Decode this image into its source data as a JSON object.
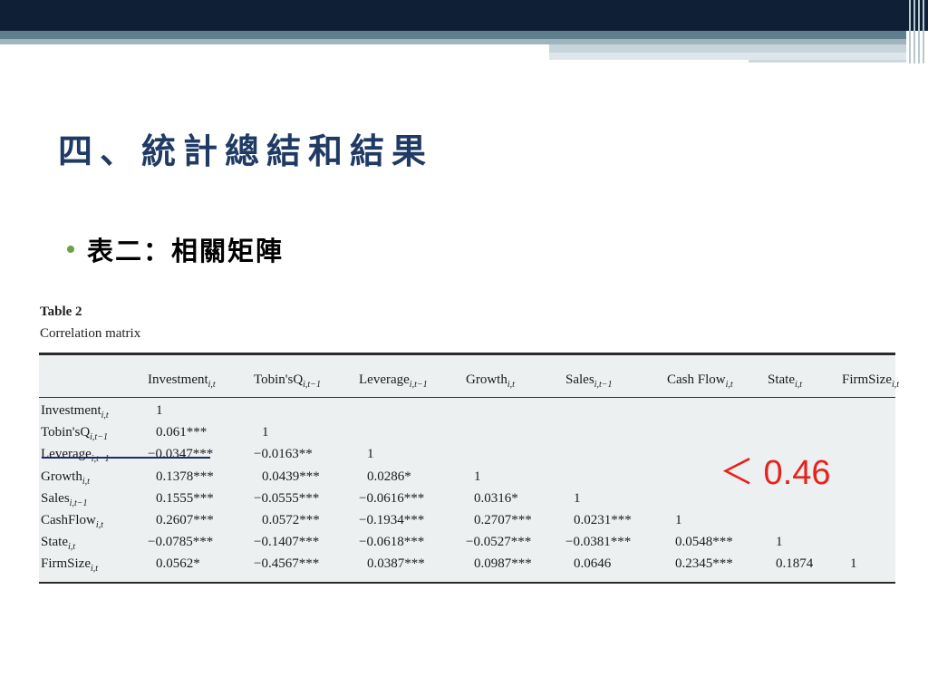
{
  "slide": {
    "title": "四、統計總結和結果",
    "bullet": "表二：相關矩陣"
  },
  "figure": {
    "label": "Table 2",
    "caption": "Correlation matrix"
  },
  "table": {
    "columns": [
      {
        "name": "Investment",
        "sub": "i,t"
      },
      {
        "name": "Tobin'sQ",
        "sub": "i,t−1"
      },
      {
        "name": "Leverage",
        "sub": "i,t−1"
      },
      {
        "name": "Growth",
        "sub": "i,t"
      },
      {
        "name": "Sales",
        "sub": "i,t−1"
      },
      {
        "name": "Cash Flow",
        "sub": "i,t"
      },
      {
        "name": "State",
        "sub": "i,t"
      },
      {
        "name": "FirmSize",
        "sub": "i,t"
      }
    ],
    "rows": [
      {
        "name": "Investment",
        "sub": "i,t",
        "values": [
          "1"
        ]
      },
      {
        "name": "Tobin'sQ",
        "sub": "i,t−1",
        "values": [
          "0.061***",
          "1"
        ]
      },
      {
        "name": "Leverage",
        "sub": "i,t−1",
        "values": [
          "−0.0347***",
          "−0.0163**",
          "1"
        ]
      },
      {
        "name": "Growth",
        "sub": "i,t",
        "values": [
          "0.1378***",
          "0.0439***",
          "0.0286*",
          "1"
        ]
      },
      {
        "name": "Sales",
        "sub": "i,t−1",
        "values": [
          "0.1555***",
          "−0.0555***",
          "−0.0616***",
          "0.0316*",
          "1"
        ]
      },
      {
        "name": "CashFlow",
        "sub": "i,t",
        "values": [
          "0.2607***",
          "0.0572***",
          "−0.1934***",
          "0.2707***",
          "0.0231***",
          "1"
        ]
      },
      {
        "name": "State",
        "sub": "i,t",
        "values": [
          "−0.0785***",
          "−0.1407***",
          "−0.0618***",
          "−0.0527***",
          "−0.0381***",
          "0.0548***",
          "1"
        ]
      },
      {
        "name": "FirmSize",
        "sub": "i,t",
        "values": [
          "0.0562*",
          "−0.4567***",
          "0.0387***",
          "0.0987***",
          "0.0646",
          "0.2345***",
          "0.1874",
          "1"
        ]
      }
    ]
  },
  "annotation": {
    "text": "＜ 0.46",
    "color": "#e8211a"
  }
}
